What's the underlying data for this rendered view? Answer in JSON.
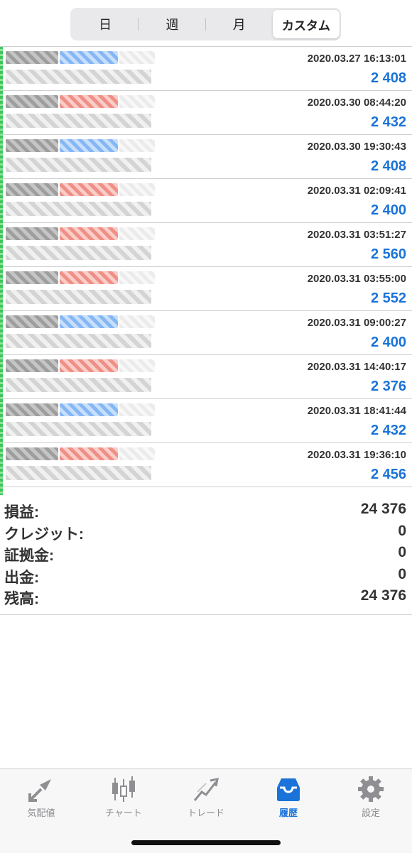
{
  "segments": [
    "日",
    "週",
    "月",
    "カスタム"
  ],
  "active_segment": "カスタム",
  "trades": [
    {
      "time": "2020.03.27 16:13:01",
      "profit": "2 408",
      "type": "buy"
    },
    {
      "time": "2020.03.30 08:44:20",
      "profit": "2 432",
      "type": "sell"
    },
    {
      "time": "2020.03.30 19:30:43",
      "profit": "2 408",
      "type": "buy"
    },
    {
      "time": "2020.03.31 02:09:41",
      "profit": "2 400",
      "type": "sell"
    },
    {
      "time": "2020.03.31 03:51:27",
      "profit": "2 560",
      "type": "sell"
    },
    {
      "time": "2020.03.31 03:55:00",
      "profit": "2 552",
      "type": "sell"
    },
    {
      "time": "2020.03.31 09:00:27",
      "profit": "2 400",
      "type": "buy"
    },
    {
      "time": "2020.03.31 14:40:17",
      "profit": "2 376",
      "type": "sell"
    },
    {
      "time": "2020.03.31 18:41:44",
      "profit": "2 432",
      "type": "buy"
    },
    {
      "time": "2020.03.31 19:36:10",
      "profit": "2 456",
      "type": "sell"
    }
  ],
  "summary": {
    "profit_label": "損益:",
    "profit_value": "24 376",
    "credit_label": "クレジット:",
    "credit_value": "0",
    "margin_label": "証拠金:",
    "margin_value": "0",
    "withdrawal_label": "出金:",
    "withdrawal_value": "0",
    "balance_label": "残高:",
    "balance_value": "24 376"
  },
  "tabs": [
    {
      "label": "気配値",
      "icon": "quotes-icon"
    },
    {
      "label": "チャート",
      "icon": "chart-icon"
    },
    {
      "label": "トレード",
      "icon": "trade-icon"
    },
    {
      "label": "履歴",
      "icon": "history-icon"
    },
    {
      "label": "設定",
      "icon": "settings-icon"
    }
  ],
  "active_tab": "履歴",
  "colors": {
    "accent": "#1a73d9",
    "profit_text": "#1a73d9",
    "buy": "#5c9ff0",
    "sell": "#ea6a5e",
    "inactive_tab": "#8e8e93"
  }
}
